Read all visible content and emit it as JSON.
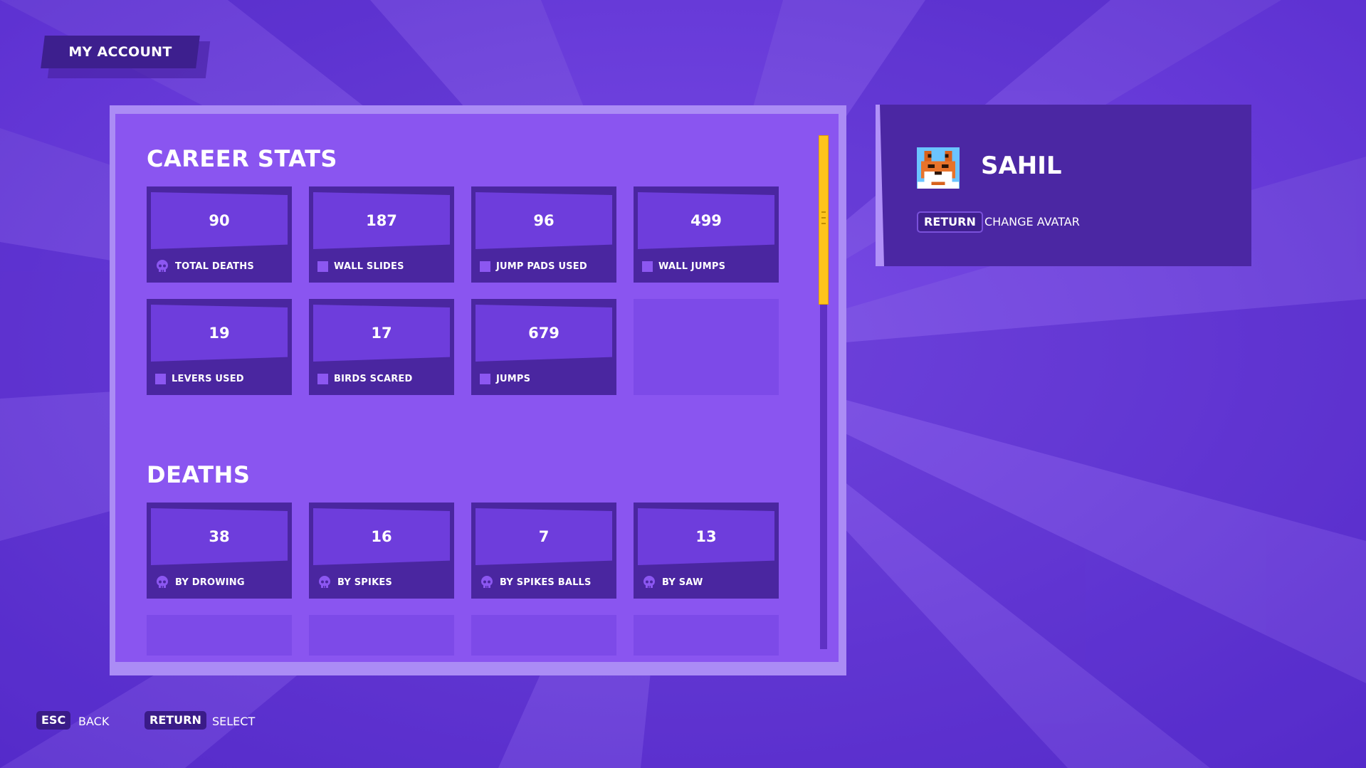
{
  "header": {
    "title": "MY ACCOUNT"
  },
  "colors": {
    "background": "#6b3fd8",
    "panel": "#8a55f0",
    "card": "#4a26a0",
    "accent_scroll": "#ffc41d"
  },
  "career_stats": {
    "title": "CAREER STATS",
    "stats": [
      {
        "value": "90",
        "label": "TOTAL DEATHS",
        "icon": "skull-icon"
      },
      {
        "value": "187",
        "label": "WALL SLIDES",
        "icon": "square-icon"
      },
      {
        "value": "96",
        "label": "JUMP PADS USED",
        "icon": "square-icon"
      },
      {
        "value": "499",
        "label": "WALL JUMPS",
        "icon": "square-icon"
      },
      {
        "value": "19",
        "label": "LEVERS USED",
        "icon": "square-icon"
      },
      {
        "value": "17",
        "label": "BIRDS SCARED",
        "icon": "square-icon"
      },
      {
        "value": "679",
        "label": "JUMPS",
        "icon": "square-icon"
      }
    ]
  },
  "deaths": {
    "title": "DEATHS",
    "stats": [
      {
        "value": "38",
        "label": "BY DROWING",
        "icon": "skull-icon"
      },
      {
        "value": "16",
        "label": "BY SPIKES",
        "icon": "skull-icon"
      },
      {
        "value": "7",
        "label": "BY SPIKES BALLS",
        "icon": "skull-icon"
      },
      {
        "value": "13",
        "label": "BY SAW",
        "icon": "skull-icon"
      }
    ]
  },
  "profile": {
    "name": "SAHIL",
    "avatar_icon": "fox-avatar-icon",
    "action_key": "RETURN",
    "action_label": "CHANGE AVATAR"
  },
  "footer": {
    "hints": [
      {
        "key": "ESC",
        "label": "BACK"
      },
      {
        "key": "RETURN",
        "label": "SELECT"
      }
    ]
  }
}
